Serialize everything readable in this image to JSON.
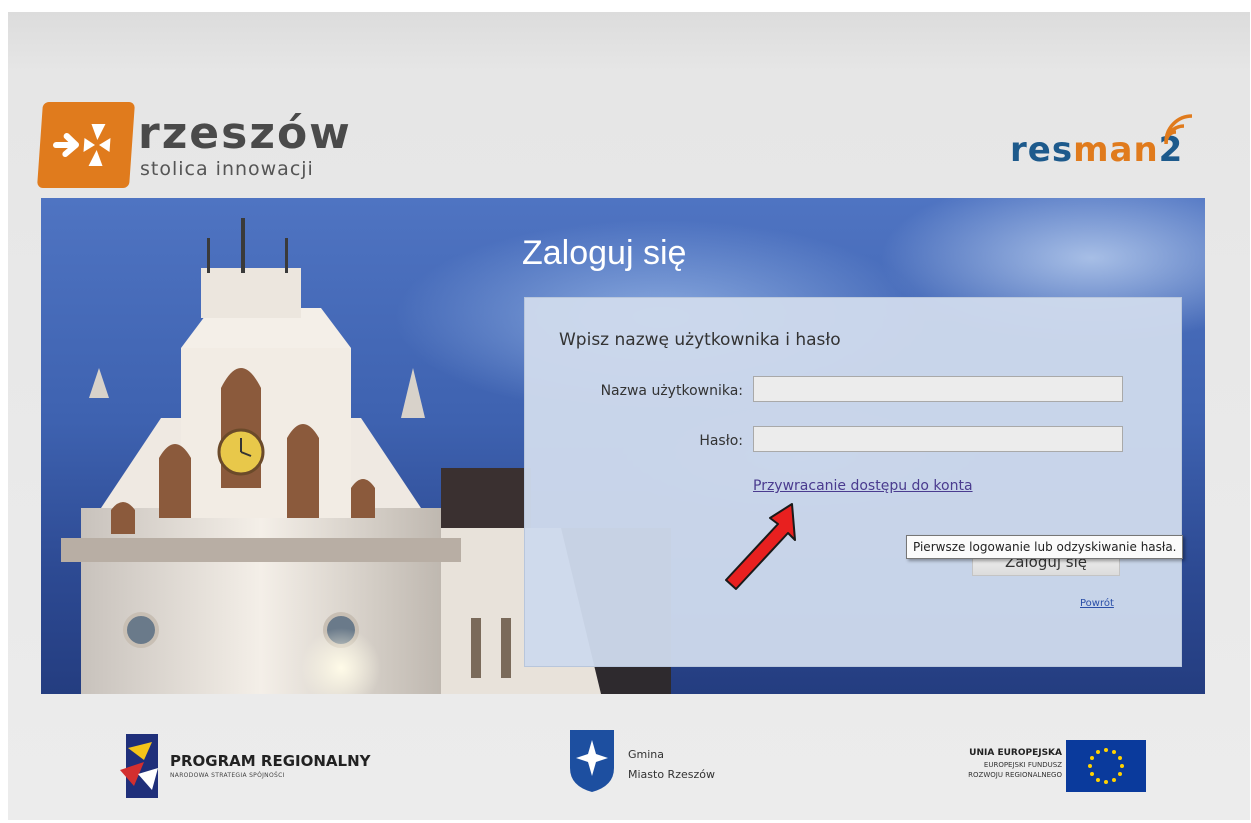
{
  "header": {
    "city_logo": {
      "word": "rzeszów",
      "tagline": "stolica innowacji"
    },
    "app_logo": {
      "prefix": "res",
      "highlight": "man",
      "suffix": "2"
    }
  },
  "login": {
    "heading": "Zaloguj się",
    "panel_title": "Wpisz nazwę użytkownika i hasło",
    "username_label": "Nazwa użytkownika:",
    "username_value": "",
    "password_label": "Hasło:",
    "password_value": "",
    "recover_link": "Przywracanie dostępu do konta",
    "tooltip": "Pierwsze logowanie lub odzyskiwanie hasła.",
    "submit_label": "Zaloguj się",
    "back_link": "Powrót"
  },
  "footer": {
    "program": {
      "title": "PROGRAM REGIONALNY",
      "subtitle": "NARODOWA STRATEGIA SPÓJNOŚCI"
    },
    "gmina": {
      "line1": "Gmina",
      "line2": "Miasto Rzeszów"
    },
    "eu": {
      "line1": "UNIA EUROPEJSKA",
      "line2": "EUROPEJSKI FUNDUSZ",
      "line3": "ROZWOJU REGIONALNEGO"
    }
  },
  "colors": {
    "brand_orange": "#e07b1d",
    "brand_blue": "#1d5a8c",
    "panel_bg": "#cedaec",
    "arrow_red": "#e8201f"
  }
}
